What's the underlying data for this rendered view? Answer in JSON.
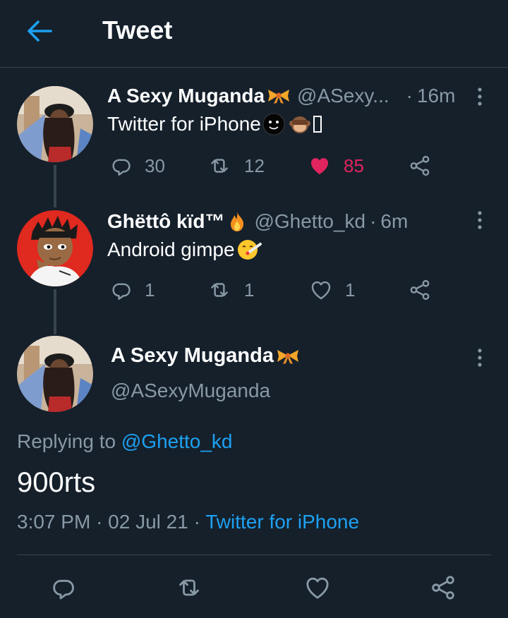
{
  "header": {
    "title": "Tweet"
  },
  "thread": [
    {
      "name": "A Sexy Muganda",
      "handle": "@ASexy...",
      "separator": "·",
      "time": "16m",
      "text": "Twitter for iPhone",
      "replies": "30",
      "retweets": "12",
      "likes": "85",
      "liked": true
    },
    {
      "name": "Ghëttô kïd™",
      "handle": "@Ghetto_kd",
      "separator": "·",
      "time": "6m",
      "text": "Android gimpe",
      "replies": "1",
      "retweets": "1",
      "likes": "1",
      "liked": false
    }
  ],
  "main_tweet": {
    "name": "A Sexy Muganda",
    "handle": "@ASexyMuganda",
    "replying_prefix": "Replying to",
    "replying_to": "@Ghetto_kd",
    "text": "900rts",
    "time": "3:07 PM",
    "date": "02 Jul 21",
    "separator": "·",
    "source": "Twitter for iPhone"
  },
  "colors": {
    "background": "#15202b",
    "accent": "#1da1f2",
    "like": "#e0245e",
    "muted": "#8899a6",
    "border": "#38444d"
  },
  "icons": [
    "back-arrow-icon",
    "more-icon",
    "reply-icon",
    "retweet-icon",
    "like-icon",
    "share-icon",
    "bow-emoji-icon",
    "fire-emoji-icon",
    "monkey-emoji-icon",
    "face-emoji-icon"
  ]
}
